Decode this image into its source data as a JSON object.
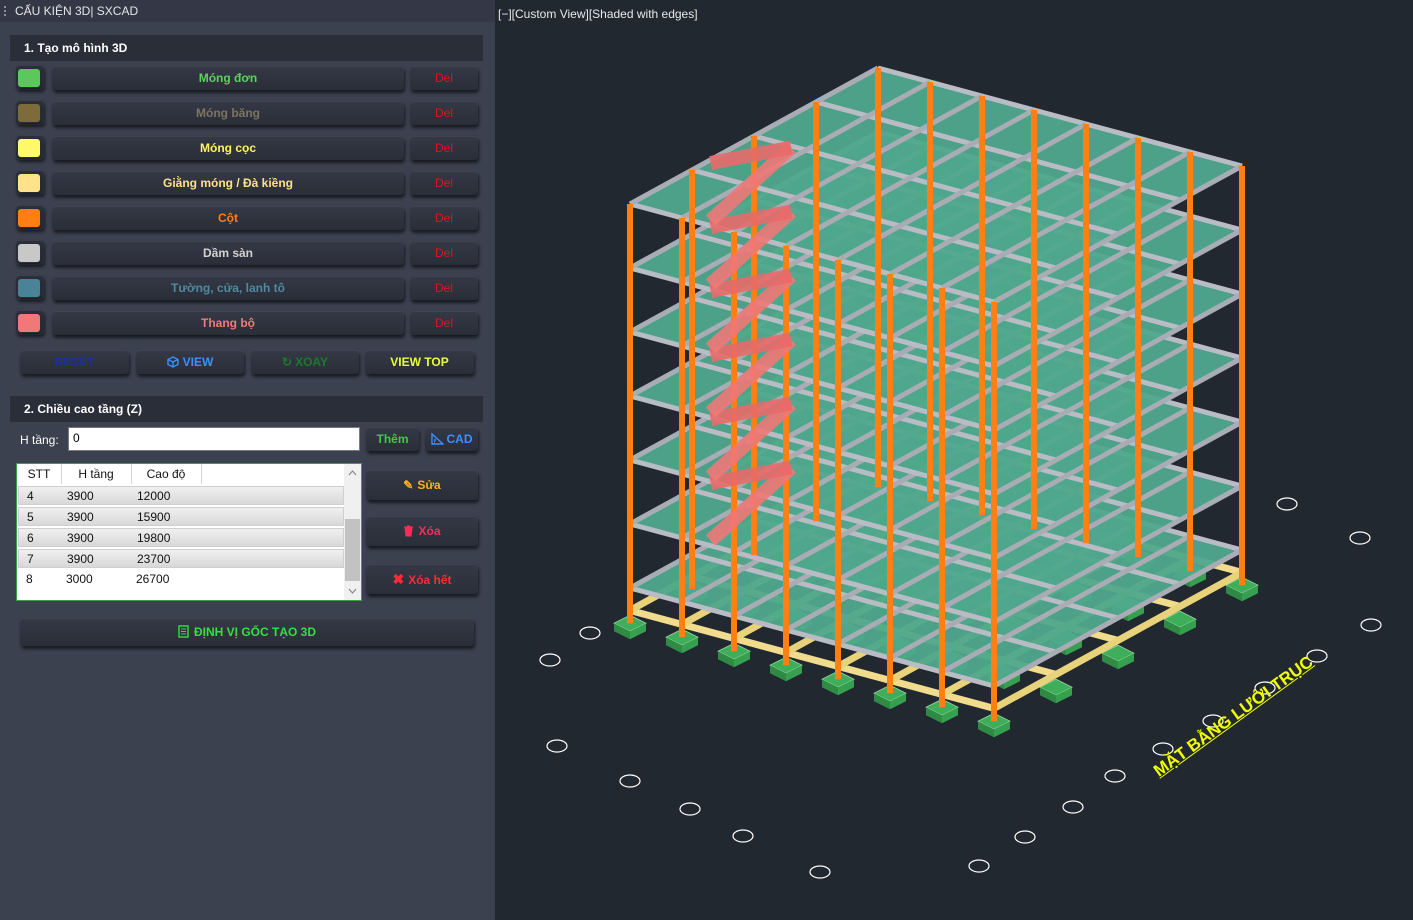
{
  "titlebar": {
    "title": "CẤU KIỆN 3D| SXCAD"
  },
  "section1": {
    "title": "1. Tạo mô hình 3D"
  },
  "layers": [
    {
      "label": "Móng đơn",
      "color": "#5cc85c",
      "text_color": "#5cd25c",
      "del": "Del"
    },
    {
      "label": "Móng băng",
      "color": "#7d6b3a",
      "text_color": "#7d7560",
      "del": "Del"
    },
    {
      "label": "Móng cọc",
      "color": "#fff96b",
      "text_color": "#fff35a",
      "del": "Del"
    },
    {
      "label": "Giằng móng / Đà kiềng",
      "color": "#ffe28a",
      "text_color": "#ffe08a",
      "del": "Del"
    },
    {
      "label": "Cột",
      "color": "#ff7f12",
      "text_color": "#ff7f12",
      "del": "Del"
    },
    {
      "label": "Dầm sàn",
      "color": "#c8c8c8",
      "text_color": "#d2d2d2",
      "del": "Del"
    },
    {
      "label": "Tường, cửa, lanh tô",
      "color": "#4a8296",
      "text_color": "#4f8aa0",
      "del": "Del"
    },
    {
      "label": "Thang bộ",
      "color": "#f07878",
      "text_color": "#f07a7a",
      "del": "Del"
    }
  ],
  "actions": {
    "reset": "RESET",
    "view": "VIEW",
    "xoay": "XOAY",
    "view_top": "VIEW TOP"
  },
  "section2": {
    "title": "2. Chiều cao tầng (Z)"
  },
  "floor_height": {
    "label": "H tầng:",
    "value": "0",
    "add": "Thêm",
    "cad": "CAD"
  },
  "floor_table": {
    "columns": [
      "STT",
      "H tầng",
      "Cao độ"
    ],
    "rows": [
      [
        "4",
        "3900",
        "12000"
      ],
      [
        "5",
        "3900",
        "15900"
      ],
      [
        "6",
        "3900",
        "19800"
      ],
      [
        "7",
        "3900",
        "23700"
      ],
      [
        "8",
        "3000",
        "26700"
      ]
    ]
  },
  "table_actions": {
    "edit": "Sửa",
    "delete": "Xóa",
    "delete_all": "Xóa hết"
  },
  "origin_button": "ĐỊNH VỊ GỐC TẠO 3D",
  "viewport": {
    "label": "[−][Custom View][Shaded with edges]",
    "plan_label": "MẶT BẰNG LƯỚI TRỤC"
  }
}
